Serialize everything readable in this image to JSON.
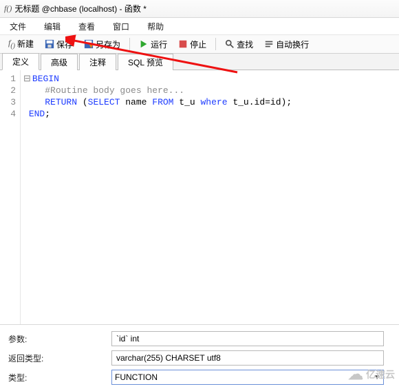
{
  "titlebar": {
    "fx": "f()",
    "title": "无标题 @chbase (localhost) - 函数 *"
  },
  "menubar": {
    "file": "文件",
    "edit": "编辑",
    "view": "查看",
    "window": "窗口",
    "help": "帮助"
  },
  "toolbar": {
    "new": "新建",
    "save": "保存",
    "saveas": "另存为",
    "run": "运行",
    "stop": "停止",
    "find": "查找",
    "wrap": "自动换行"
  },
  "tabs": {
    "def": "定义",
    "adv": "高级",
    "comment": "注释",
    "sql": "SQL 预览"
  },
  "code": {
    "l1_kw": "BEGIN",
    "l2_cm": "#Routine body goes here...",
    "l3a": "RETURN ",
    "l3b": "(",
    "l3c": "SELECT",
    "l3d": " name ",
    "l3e": "FROM",
    "l3f": " t_u ",
    "l3g": "where",
    "l3h": " t_u.id=id);",
    "l4_kw": "END",
    "l4_semi": ";"
  },
  "form": {
    "params_label": "参数:",
    "params_value": "`id` int",
    "ret_label": "返回类型:",
    "ret_value": "varchar(255) CHARSET utf8",
    "type_label": "类型:",
    "type_value": "FUNCTION"
  },
  "watermark": "亿速云"
}
